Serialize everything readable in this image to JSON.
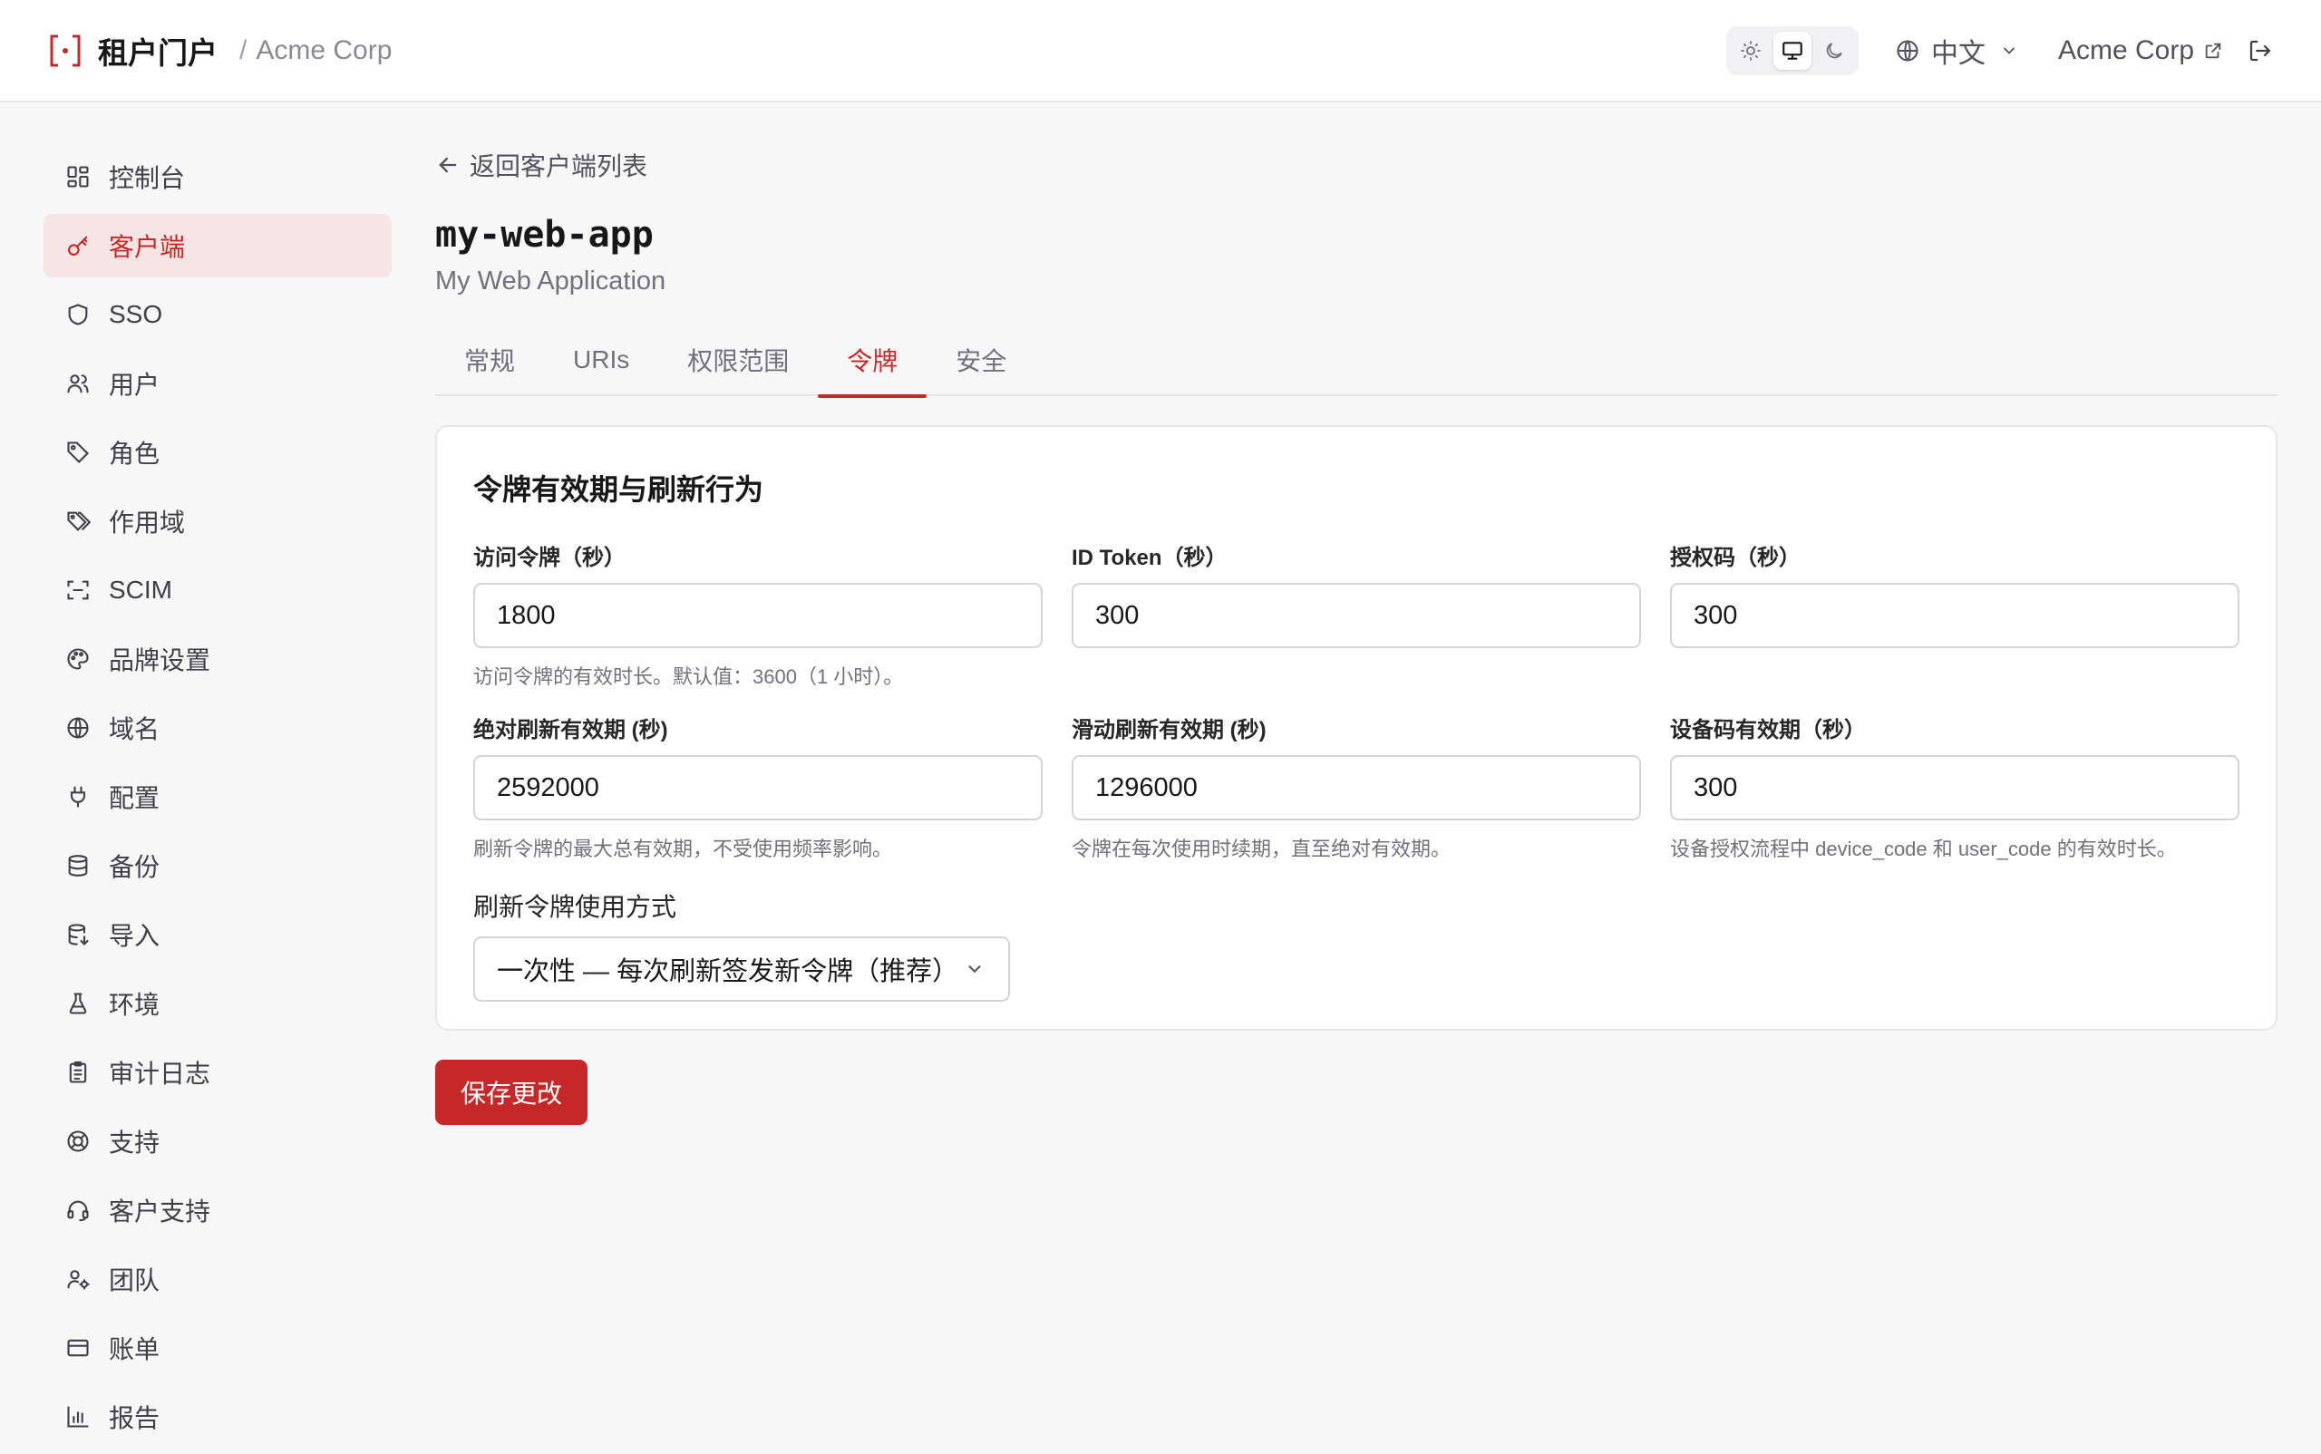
{
  "colors": {
    "accent": "#c62828",
    "accent_bg": "#f7e4e4"
  },
  "header": {
    "brand_logo_icon": "bracket-logo-icon",
    "brand_name": "租户门户",
    "separator": "/",
    "org_name": "Acme Corp",
    "theme_modes": [
      "light",
      "system",
      "dark"
    ],
    "active_theme": "system",
    "language": "中文",
    "tenant_name": "Acme Corp"
  },
  "sidebar": {
    "items": [
      {
        "label": "控制台",
        "icon": "dashboard-icon"
      },
      {
        "label": "客户端",
        "icon": "key-icon",
        "active": true
      },
      {
        "label": "SSO",
        "icon": "shield-icon"
      },
      {
        "label": "用户",
        "icon": "users-icon"
      },
      {
        "label": "角色",
        "icon": "tag-icon"
      },
      {
        "label": "作用域",
        "icon": "tags-icon"
      },
      {
        "label": "SCIM",
        "icon": "scan-icon"
      },
      {
        "label": "品牌设置",
        "icon": "palette-icon"
      },
      {
        "label": "域名",
        "icon": "globe-icon"
      },
      {
        "label": "配置",
        "icon": "plug-icon"
      },
      {
        "label": "备份",
        "icon": "database-icon"
      },
      {
        "label": "导入",
        "icon": "database-import-icon"
      },
      {
        "label": "环境",
        "icon": "flask-icon"
      },
      {
        "label": "审计日志",
        "icon": "clipboard-icon"
      },
      {
        "label": "支持",
        "icon": "lifebuoy-icon"
      },
      {
        "label": "客户支持",
        "icon": "headset-icon"
      },
      {
        "label": "团队",
        "icon": "user-cog-icon"
      },
      {
        "label": "账单",
        "icon": "credit-card-icon"
      },
      {
        "label": "报告",
        "icon": "bar-chart-icon"
      }
    ]
  },
  "main": {
    "back_link": "返回客户端列表",
    "client_id": "my-web-app",
    "client_name": "My Web Application",
    "tabs": [
      {
        "label": "常规"
      },
      {
        "label": "URIs"
      },
      {
        "label": "权限范围"
      },
      {
        "label": "令牌",
        "active": true
      },
      {
        "label": "安全"
      }
    ],
    "card": {
      "title": "令牌有效期与刷新行为",
      "fields": [
        {
          "label": "访问令牌（秒）",
          "value": "1800",
          "help": "访问令牌的有效时长。默认值：3600（1 小时）。"
        },
        {
          "label": "ID Token（秒）",
          "value": "300",
          "help": ""
        },
        {
          "label": "授权码（秒）",
          "value": "300",
          "help": ""
        },
        {
          "label": "绝对刷新有效期 (秒)",
          "value": "2592000",
          "help": "刷新令牌的最大总有效期，不受使用频率影响。"
        },
        {
          "label": "滑动刷新有效期 (秒)",
          "value": "1296000",
          "help": "令牌在每次使用时续期，直至绝对有效期。"
        },
        {
          "label": "设备码有效期（秒）",
          "value": "300",
          "help": "设备授权流程中 device_code 和 user_code 的有效时长。"
        }
      ],
      "refresh_usage": {
        "label": "刷新令牌使用方式",
        "selected": "一次性 — 每次刷新签发新令牌（推荐）"
      }
    },
    "save_button": "保存更改"
  }
}
